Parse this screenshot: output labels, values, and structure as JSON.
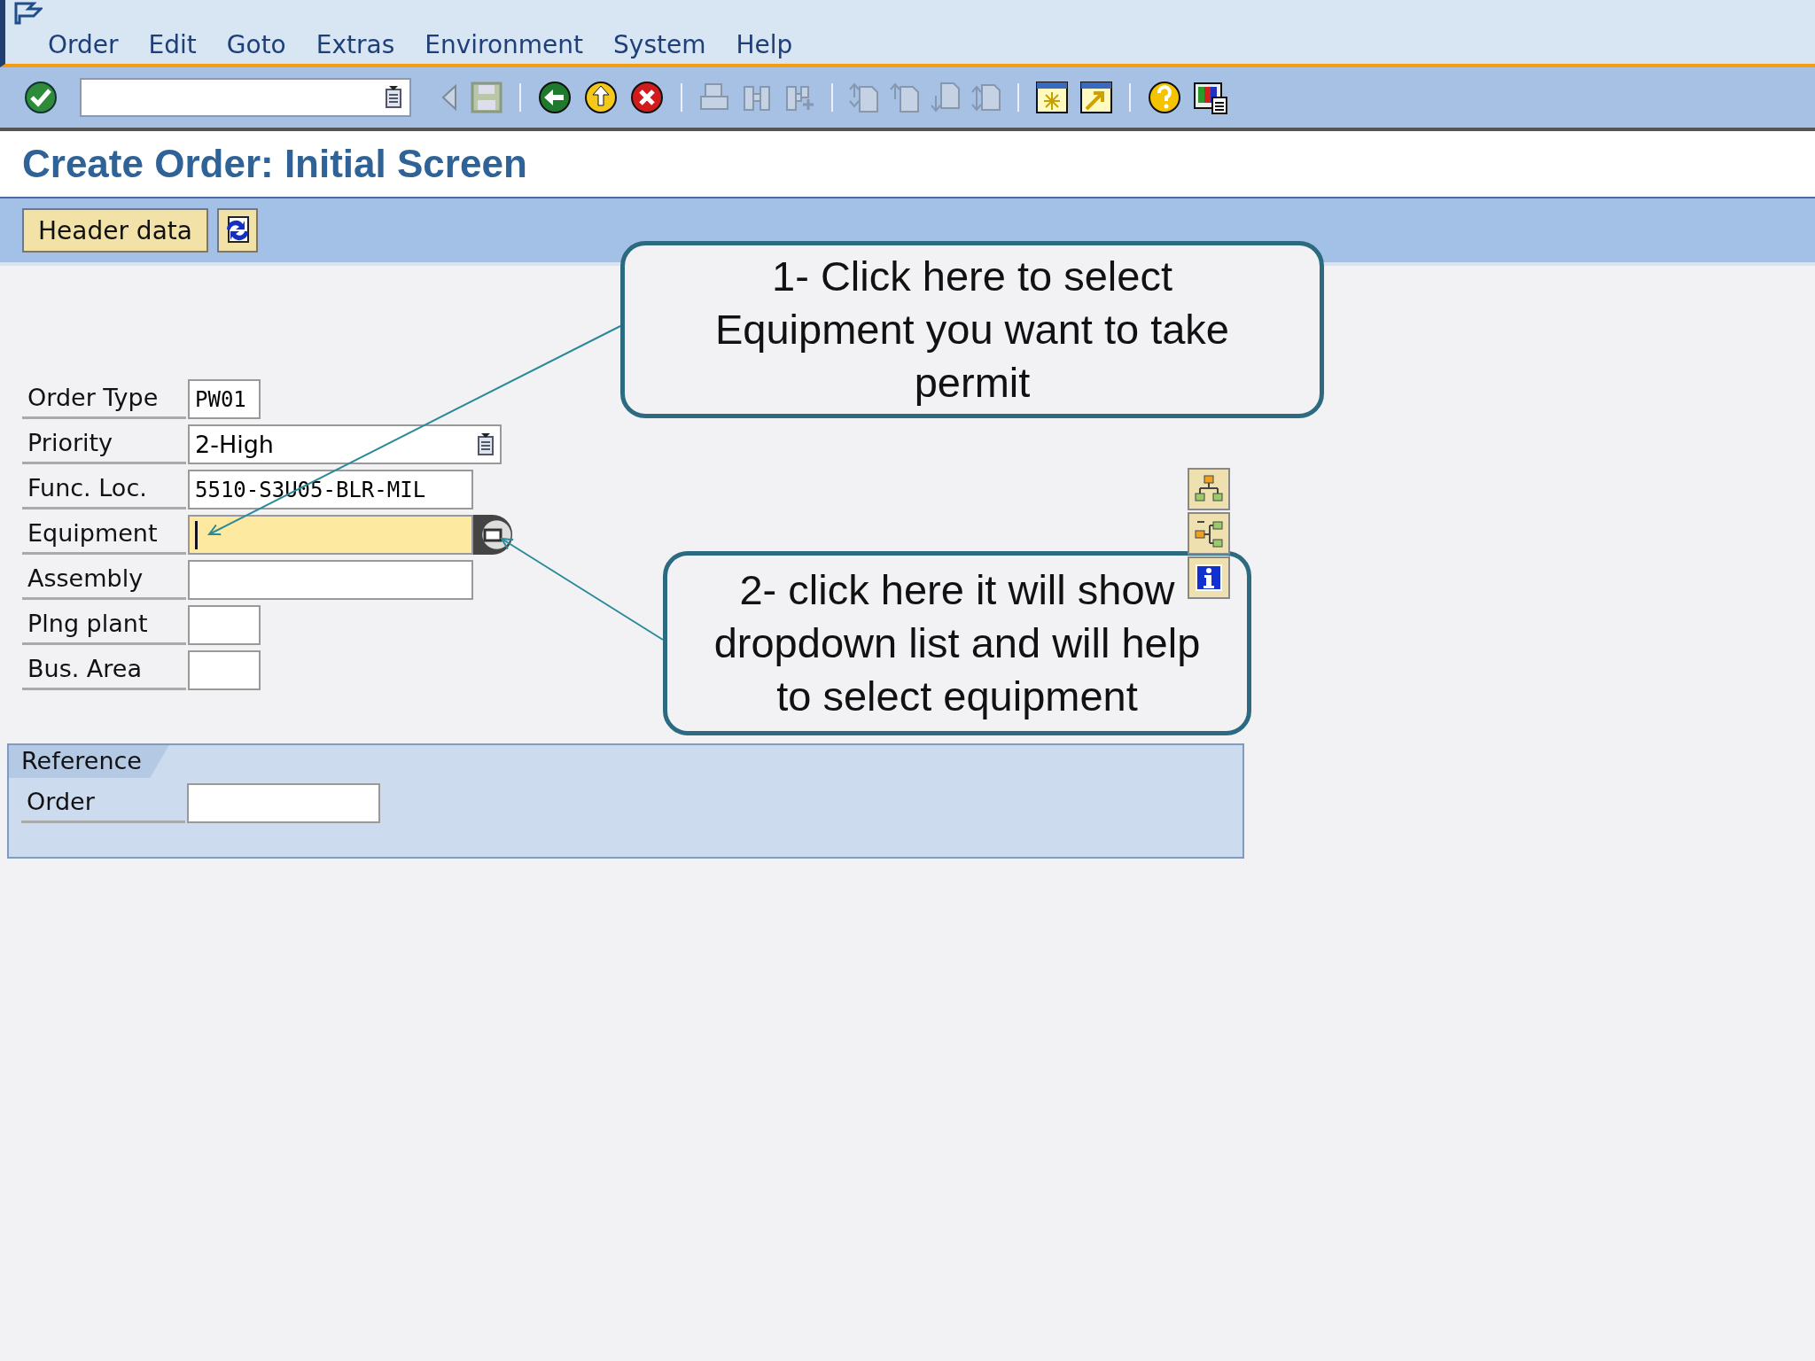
{
  "menu": [
    "Order",
    "Edit",
    "Goto",
    "Extras",
    "Environment",
    "System",
    "Help"
  ],
  "title": "Create Order: Initial Screen",
  "app_toolbar": {
    "button": "Header data"
  },
  "fields": [
    {
      "label": "Order Type",
      "value": "PW01",
      "kind": "code",
      "focused": false
    },
    {
      "label": "Priority",
      "value": "2-High",
      "kind": "dropdown",
      "focused": false
    },
    {
      "label": "Func. Loc.",
      "value": "5510-S3U05-BLR-MIL",
      "kind": "code",
      "focused": false
    },
    {
      "label": "Equipment",
      "kind": "search",
      "focused": true
    },
    {
      "label": "Assembly",
      "kind": "code",
      "focused": false
    },
    {
      "label": "Plng plant",
      "kind": "code",
      "focused": false
    },
    {
      "label": "Bus. Area",
      "kind": "code",
      "focused": false
    }
  ],
  "reference": {
    "title": "Reference",
    "fields": [
      {
        "label": "Order"
      }
    ]
  },
  "callouts": [
    {
      "text": "1- Click here to select Equipment you want to take permit"
    },
    {
      "text": "2- click here it will show dropdown list and will help to select equipment"
    }
  ]
}
